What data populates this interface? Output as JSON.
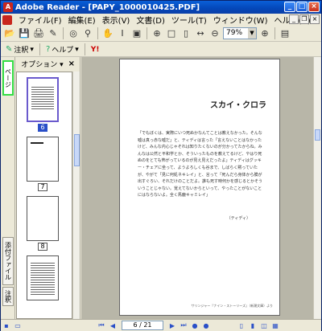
{
  "window": {
    "title": "Adobe Reader - [PAPY_1000010425.PDF]",
    "min": "_",
    "max": "□",
    "close": "×"
  },
  "menu": {
    "items": [
      "ファイル(F)",
      "編集(E)",
      "表示(V)",
      "文書(D)",
      "ツール(T)",
      "ウィンドウ(W)",
      "ヘルプ(H)"
    ]
  },
  "toolbar": {
    "zoom": "79%"
  },
  "toolbar2": {
    "annotate": "注釈",
    "help": "ヘルプ",
    "yahoo": "Y!"
  },
  "sidebar": {
    "tab_pages": "ページ",
    "tab_attachments": "添付ファイル",
    "tab_comments": "注釈"
  },
  "nav": {
    "options": "オプション ▾",
    "close": "×",
    "pages": [
      "6",
      "7",
      "8"
    ]
  },
  "document": {
    "heading": "スカイ・クロラ",
    "body": "「でもぼくは、実際にいつ死ぬかなんてことは教えなかった。そんな嘘は真っ赤な嘘だ」と、ティディは言った「言えないことはなかったけど、みんな内心じゃそれは知りたくないのが分かってたからね。みんなは公然と平和学とか、そういったものを教えてるけど、やはり死ぬのをとても怖がっているのが見え見えだったよ」ティディはグッキー・チェアに坐って、ようよろしくも谷まで、しばらく黙っていたが、やがて「見に何処ネキレイ」と、言って「死んだら身体から膜が出すぐろい、それだけのことだよ。誰も死す時何かを感じるとかそういうことじゃない。覚えてないからといって、やったことがないことにはならないよ。全く馬鹿キャミレイ」",
    "attribution": "（ティディ）",
    "footer": "サリンジャー『ナイン・ストーリーズ』（新潮文庫）より"
  },
  "status": {
    "page": "6 / 21"
  }
}
